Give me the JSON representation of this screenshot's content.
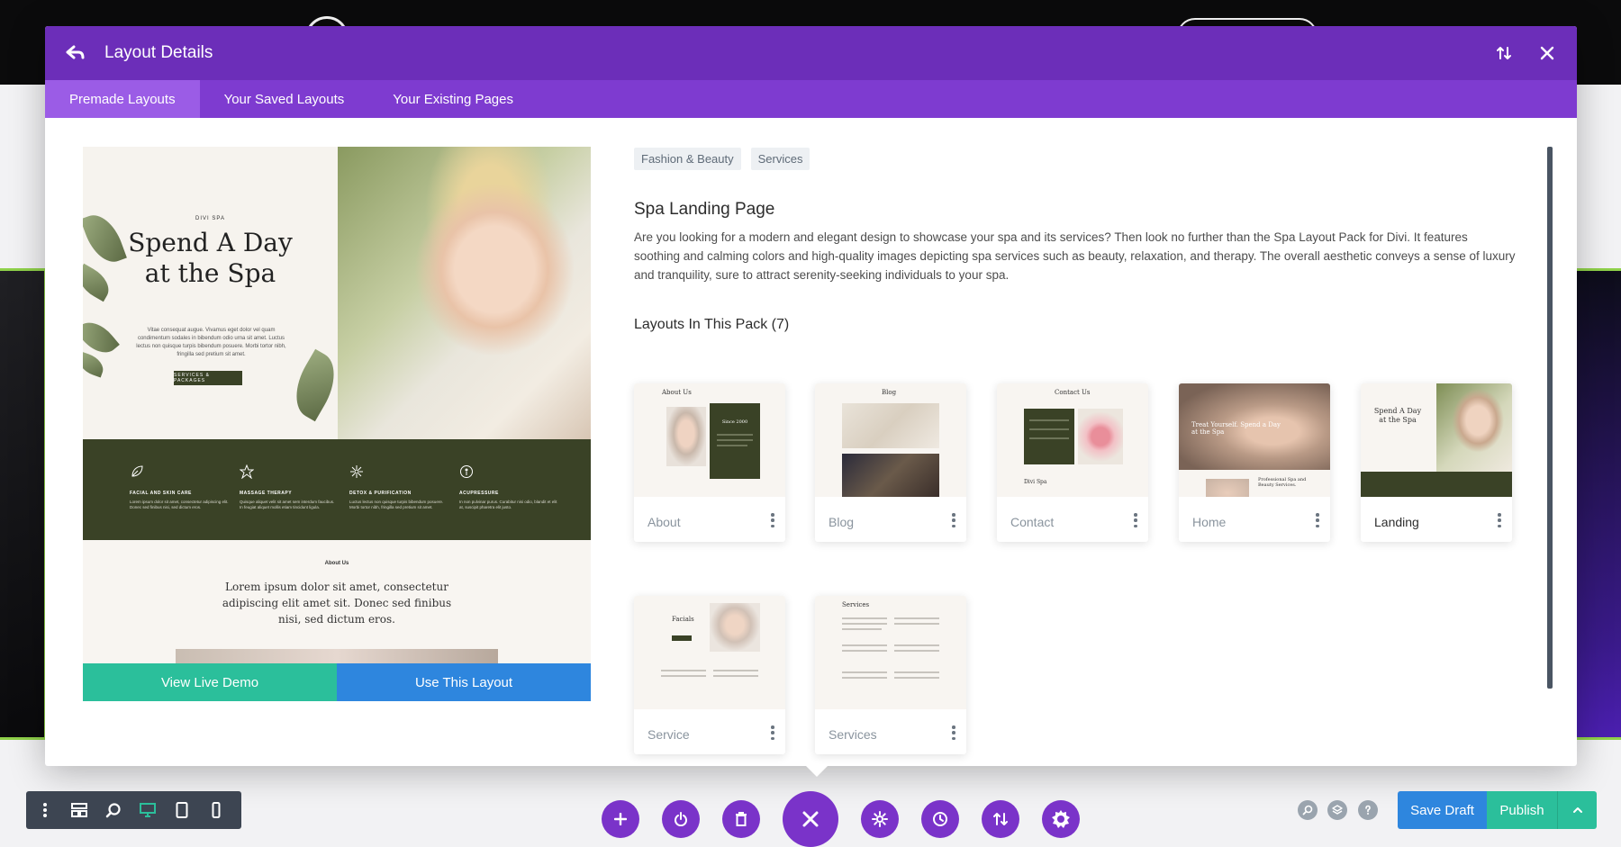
{
  "modal": {
    "title": "Layout Details",
    "tabs": [
      {
        "label": "Premade Layouts",
        "active": true
      },
      {
        "label": "Your Saved Layouts",
        "active": false
      },
      {
        "label": "Your Existing Pages",
        "active": false
      }
    ]
  },
  "preview": {
    "kicker": "DIVI SPA",
    "hero_title": "Spend A Day at the Spa",
    "hero_body": "Vitae consequat augue. Vivamus eget dolor vel quam condimentum sodales in bibendum odio urna sit amet. Luctus lectus non quisque turpis bibendum posuere. Morbi tortor nibh, fringilla sed pretium sit amet.",
    "hero_button": "SERVICES & PACKAGES",
    "services": [
      {
        "title": "FACIAL AND SKIN CARE",
        "desc": "Lorem ipsum dolor sit amet, consectetur adipiscing elit. Donec sed finibus nisi, sed dictum eros."
      },
      {
        "title": "MASSAGE THERAPY",
        "desc": "Quisque aliquet velit sit amet sem interdum faucibus. In feugiat aliquet mollis etiam tincidunt ligula."
      },
      {
        "title": "DETOX & PURIFICATION",
        "desc": "Luctus lectus non quisque turpis bibendum posuere. Morbi tortor nibh, fringilla sed pretium sit amet."
      },
      {
        "title": "ACUPRESSURE",
        "desc": "In non pulvinar purus. Curabitur nisi odio, blandit et elit at, suscipit pharetra elit justo."
      }
    ],
    "about_kicker": "About Us",
    "about_text": "Lorem ipsum dolor sit amet, consectetur adipiscing elit amet sit. Donec sed finibus nisi, sed dictum eros.",
    "view_demo_label": "View Live Demo",
    "use_layout_label": "Use This Layout"
  },
  "details": {
    "tags": [
      "Fashion & Beauty",
      "Services"
    ],
    "name": "Spa Landing Page",
    "description": "Are you looking for a modern and elegant design to showcase your spa and its services? Then look no further than the Spa Layout Pack for Divi. It features soothing and calming colors and high-quality images depicting spa services such as beauty, relaxation, and therapy. The overall aesthetic conveys a sense of luxury and tranquility, sure to attract serenity-seeking individuals to your spa.",
    "pack_title": "Layouts In This Pack (7)"
  },
  "layouts": [
    {
      "label": "About",
      "thumb_title": "About Us",
      "thumb_caption": "Since 2000"
    },
    {
      "label": "Blog",
      "thumb_title": "Blog"
    },
    {
      "label": "Contact",
      "thumb_title": "Contact Us",
      "thumb_caption": "Divi Spa"
    },
    {
      "label": "Home",
      "thumb_title": "Treat Yourself. Spend a Day at the Spa",
      "thumb_caption": "Professional Spa and Beauty Services."
    },
    {
      "label": "Landing",
      "thumb_title": "Spend A Day at the Spa",
      "active": true
    },
    {
      "label": "Service",
      "thumb_title": "Facials"
    },
    {
      "label": "Services",
      "thumb_title": "Services"
    }
  ],
  "footer": {
    "save_draft_label": "Save Draft",
    "publish_label": "Publish"
  },
  "colors": {
    "header_purple": "#6c2eb9",
    "tab_purple": "#7e3bd0",
    "active_tab": "#9b5ce6",
    "demo_teal": "#2bbf9b",
    "use_blue": "#2e86de",
    "spa_green": "#3a4226"
  }
}
